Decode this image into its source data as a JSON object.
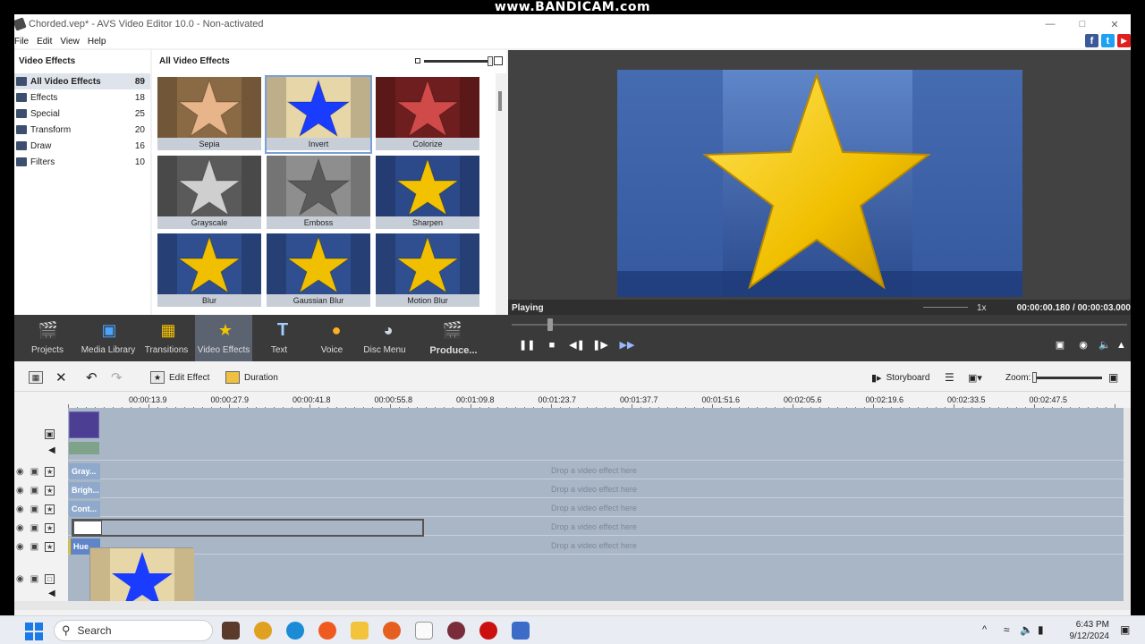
{
  "recorder_watermark": "www.BANDICAM.com",
  "window": {
    "title": "Chorded.vep* - AVS Video Editor 10.0 - Non-activated"
  },
  "menu": [
    "File",
    "Edit",
    "View",
    "Help"
  ],
  "social": [
    "f",
    "t",
    "▶"
  ],
  "tree": {
    "header": "Video Effects",
    "items": [
      {
        "label": "All Video Effects",
        "count": "89"
      },
      {
        "label": "Effects",
        "count": "18"
      },
      {
        "label": "Special",
        "count": "25"
      },
      {
        "label": "Transform",
        "count": "20"
      },
      {
        "label": "Draw",
        "count": "16"
      },
      {
        "label": "Filters",
        "count": "10"
      }
    ]
  },
  "effects": {
    "header": "All Video Effects",
    "items": [
      {
        "label": "Sepia",
        "bg": "#8a6a44",
        "star": "#e8b48a"
      },
      {
        "label": "Invert",
        "bg": "#e6d6a8",
        "star": "#1a3cff"
      },
      {
        "label": "Colorize",
        "bg": "#6e1e1e",
        "star": "#d04a4a"
      },
      {
        "label": "Grayscale",
        "bg": "#5a5a5a",
        "star": "#cfcfcf"
      },
      {
        "label": "Emboss",
        "bg": "#8e8e8e",
        "star": "#5a5a5a"
      },
      {
        "label": "Sharpen",
        "bg": "#2c4a8a",
        "star": "#f2c200"
      },
      {
        "label": "Blur",
        "bg": "#2f4f90",
        "star": "#f0c000"
      },
      {
        "label": "Gaussian Blur",
        "bg": "#2f4f90",
        "star": "#f0c000"
      },
      {
        "label": "Motion Blur",
        "bg": "#2f4f90",
        "star": "#f0c000"
      }
    ]
  },
  "playback": {
    "status": "Playing",
    "speed": "1x",
    "time": "00:00:00.180 / 00:00:03.000"
  },
  "modules": [
    {
      "label": "Projects",
      "icon": "clapper-icon"
    },
    {
      "label": "Media Library",
      "icon": "film-icon"
    },
    {
      "label": "Transitions",
      "icon": "transitions-icon"
    },
    {
      "label": "Video Effects",
      "icon": "star-icon"
    },
    {
      "label": "Text",
      "icon": "text-icon"
    },
    {
      "label": "Voice",
      "icon": "microphone-icon"
    },
    {
      "label": "Disc Menu",
      "icon": "disc-icon"
    },
    {
      "label": "Produce...",
      "icon": "produce-icon"
    }
  ],
  "timeline_toolbar": {
    "edit_effect": "Edit Effect",
    "duration": "Duration",
    "storyboard": "Storyboard",
    "zoom": "Zoom:"
  },
  "ruler": [
    "00:00:13.9",
    "00:00:27.9",
    "00:00:41.8",
    "00:00:55.8",
    "00:01:09.8",
    "00:01:23.7",
    "00:01:37.7",
    "00:01:51.6",
    "00:02:05.6",
    "00:02:19.6",
    "00:02:33.5",
    "00:02:47.5"
  ],
  "tracks": [
    {
      "clip": "Gray...",
      "drop": "Drop a video effect here"
    },
    {
      "clip": "Brigh...",
      "drop": "Drop a video effect here"
    },
    {
      "clip": "Cont...",
      "drop": "Drop a video effect here"
    },
    {
      "clip": "",
      "drop": "Drop a video effect here"
    },
    {
      "clip": "Hue",
      "drop": "Drop a video effect here"
    }
  ],
  "taskbar": {
    "search": "Search",
    "time": "6:43 PM",
    "date": "9/12/2024"
  }
}
